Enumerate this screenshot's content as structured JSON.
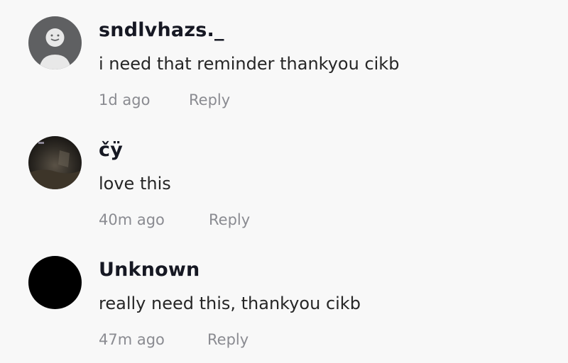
{
  "comments": [
    {
      "username": "sndlvhazs._",
      "text": "i need that reminder thankyou cikb",
      "time": "1d ago",
      "reply_label": "Reply",
      "avatar": "default-avatar-icon"
    },
    {
      "username": "čÿ",
      "text": "love this",
      "time": "40m ago",
      "reply_label": "Reply",
      "avatar": "photo-avatar"
    },
    {
      "username": "Unknown",
      "text": "really need this, thankyou cikb",
      "time": "47m ago",
      "reply_label": "Reply",
      "avatar": "black-avatar"
    }
  ],
  "colors": {
    "background": "#f8f8f8",
    "username": "#161823",
    "comment_text": "#262626",
    "meta_text": "#8a8b91"
  }
}
